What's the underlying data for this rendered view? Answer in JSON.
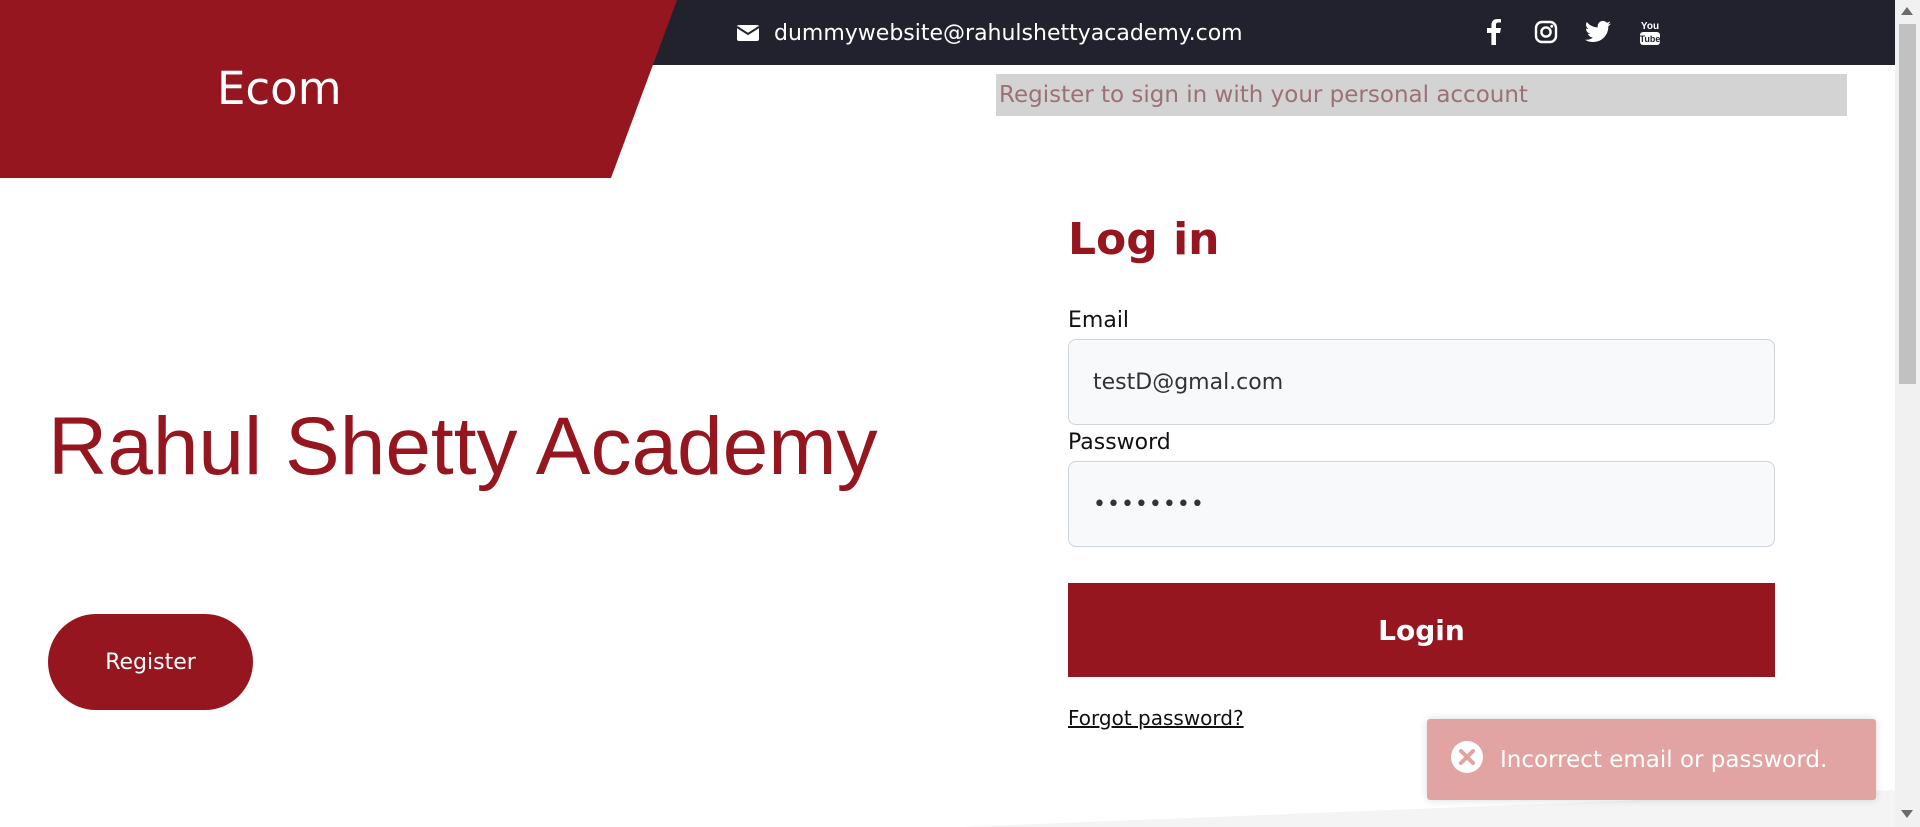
{
  "header": {
    "brand": "Ecom",
    "contact_email": "dummywebsite@rahulshettyacademy.com",
    "tagline": "Register to sign in with your personal account",
    "socials": [
      "facebook-icon",
      "instagram-icon",
      "twitter-icon",
      "youtube-icon"
    ]
  },
  "hero": {
    "title": "Rahul Shetty Academy",
    "register_label": "Register"
  },
  "login": {
    "title": "Log in",
    "email_label": "Email",
    "email_value": "testD@gmal.com",
    "password_label": "Password",
    "password_value": "••••••••",
    "button_label": "Login",
    "forgot_label": "Forgot password?"
  },
  "toast": {
    "message": "Incorrect email or password.",
    "icon": "error-circle-icon"
  },
  "colors": {
    "brand": "#961620",
    "topbar": "#22222f",
    "toast": "#e2a4a3"
  }
}
